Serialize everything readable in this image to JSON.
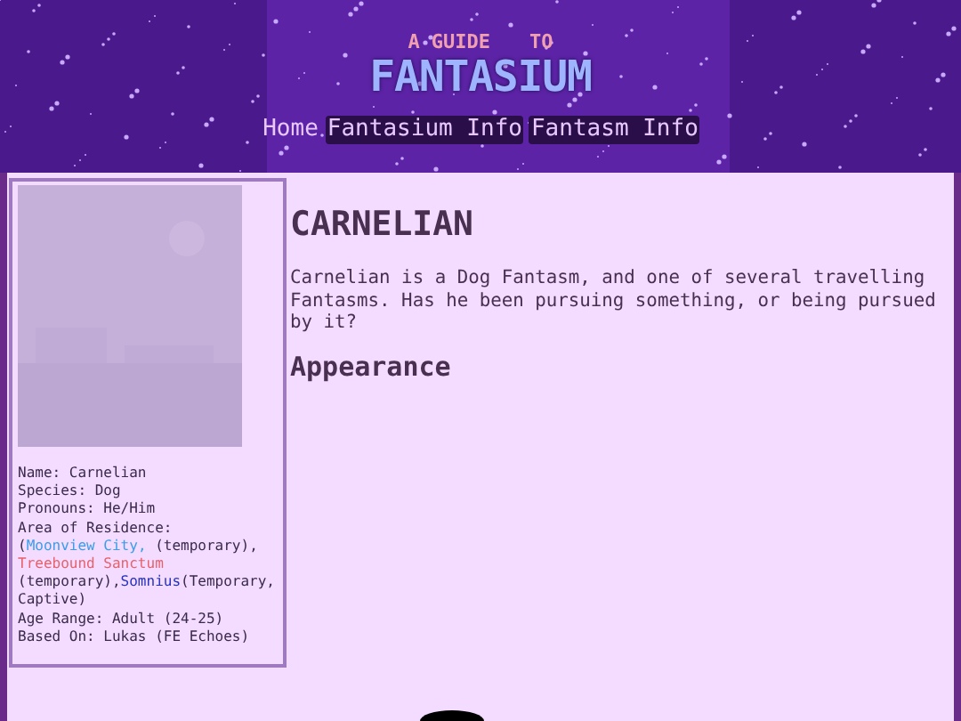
{
  "logo": {
    "top_left": "A GUIDE",
    "top_right": "TO",
    "main": "FANTASIUM"
  },
  "nav": [
    {
      "label": "Home",
      "highlighted": false
    },
    {
      "label": "Fantasium Info",
      "highlighted": true
    },
    {
      "label": "Fantasm Info",
      "highlighted": true
    }
  ],
  "profile": {
    "lines": [
      [
        {
          "kind": "text",
          "text": "Name: Carnelian"
        }
      ],
      [
        {
          "kind": "text",
          "text": "Species: Dog"
        }
      ],
      [
        {
          "kind": "text",
          "text": "Pronouns: He/Him"
        }
      ],
      [
        {
          "kind": "text",
          "text": "Area of Residence: ("
        },
        {
          "kind": "link",
          "text": "Moonview City,",
          "color": "#3a9de8"
        },
        {
          "kind": "text",
          "text": " (temporary), "
        },
        {
          "kind": "link",
          "text": "Treebound Sanctum",
          "color": "#e8606a"
        },
        {
          "kind": "text",
          "text": " (temporary),"
        },
        {
          "kind": "link",
          "text": "Somnius",
          "color": "#2430c0"
        },
        {
          "kind": "text",
          "text": "(Temporary, Captive)"
        }
      ],
      [
        {
          "kind": "text",
          "text": "Age Range: Adult (24-25)"
        }
      ],
      [
        {
          "kind": "text",
          "text": "Based On: Lukas (FE Echoes)"
        }
      ]
    ]
  },
  "article": {
    "title": "CARNELIAN",
    "intro": "Carnelian is a Dog Fantasm, and one of several travelling Fantasms. Has he been pursuing something, or being pursued by it?",
    "sections": [
      "Appearance"
    ]
  }
}
